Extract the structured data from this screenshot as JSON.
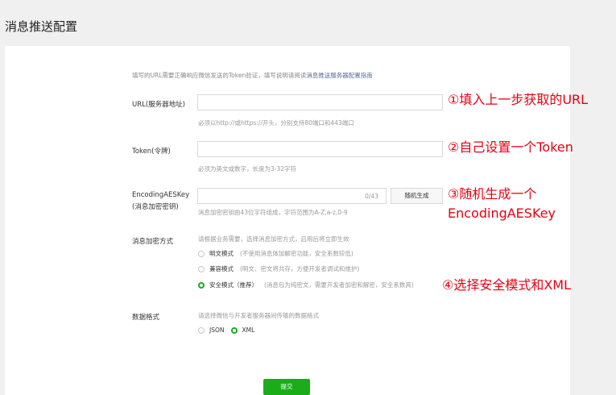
{
  "page_title": "消息推送配置",
  "intro": {
    "text": "填写的URL需要正确响应微信发送的Token验证，填写说明请阅读",
    "link": "消息推送服务器配置指南"
  },
  "url_field": {
    "label": "URL(服务器地址)",
    "value": "",
    "hint": "必须以http://或https://开头，分别支持80端口和443端口"
  },
  "token_field": {
    "label": "Token(令牌)",
    "value": "",
    "hint": "必须为英文或数字，长度为3-32字符"
  },
  "aes_field": {
    "label_line1": "EncodingAESKey",
    "label_line2": "(消息加密密钥)",
    "value": "",
    "counter": "0/43",
    "generate_button": "随机生成",
    "hint": "消息加密密钥由43位字符组成，字符范围为A-Z,a-z,0-9"
  },
  "encryption": {
    "label": "消息加密方式",
    "hint": "请根据业务需要，选择消息加密方式，启用后将立即生效",
    "options": [
      {
        "name": "明文模式",
        "desc": "(不使用消息体加解密功能，安全系数较低)",
        "checked": false
      },
      {
        "name": "兼容模式",
        "desc": "(明文、密文将共存，方便开发者调试和维护)",
        "checked": false
      },
      {
        "name": "安全模式（推荐）",
        "desc": "(消息包为纯密文，需要开发者加密和解密，安全系数高)",
        "checked": true
      }
    ]
  },
  "data_format": {
    "label": "数据格式",
    "hint": "请选择微信与开发者服务器间传输的数据格式",
    "options": [
      {
        "name": "JSON",
        "checked": false
      },
      {
        "name": "XML",
        "checked": true
      }
    ]
  },
  "submit_button": "提交",
  "annotations": {
    "step1": "①填入上一步获取的URL",
    "step2": "②自己设置一个Token",
    "step3_line1": "③随机生成一个",
    "step3_line2": "EncodingAESKey",
    "step4": "④选择安全模式和XML"
  },
  "colors": {
    "accent_green": "#1aad19",
    "annotation_red": "#e60012",
    "link_blue": "#576b95"
  }
}
